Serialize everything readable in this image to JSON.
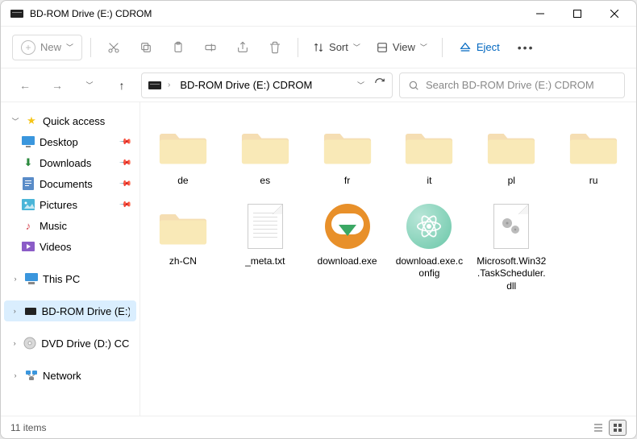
{
  "window": {
    "title": "BD-ROM Drive (E:) CDROM"
  },
  "toolbar": {
    "new": "New",
    "sort": "Sort",
    "view": "View",
    "eject": "Eject"
  },
  "address": {
    "path": "BD-ROM Drive (E:) CDROM"
  },
  "search": {
    "placeholder": "Search BD-ROM Drive (E:) CDROM"
  },
  "sidebar": {
    "quick_access": "Quick access",
    "desktop": "Desktop",
    "downloads": "Downloads",
    "documents": "Documents",
    "pictures": "Pictures",
    "music": "Music",
    "videos": "Videos",
    "this_pc": "This PC",
    "bdrom": "BD-ROM Drive (E:) C",
    "dvd": "DVD Drive (D:) CCCC",
    "network": "Network"
  },
  "files": [
    {
      "name": "de",
      "type": "folder"
    },
    {
      "name": "es",
      "type": "folder"
    },
    {
      "name": "fr",
      "type": "folder"
    },
    {
      "name": "it",
      "type": "folder"
    },
    {
      "name": "pl",
      "type": "folder"
    },
    {
      "name": "ru",
      "type": "folder"
    },
    {
      "name": "zh-CN",
      "type": "folder"
    },
    {
      "name": "_meta.txt",
      "type": "txt"
    },
    {
      "name": "download.exe",
      "type": "dlexe"
    },
    {
      "name": "download.exe.config",
      "type": "cfg"
    },
    {
      "name": "Microsoft.Win32.TaskScheduler.dll",
      "type": "dll"
    }
  ],
  "status": {
    "count": "11 items"
  }
}
